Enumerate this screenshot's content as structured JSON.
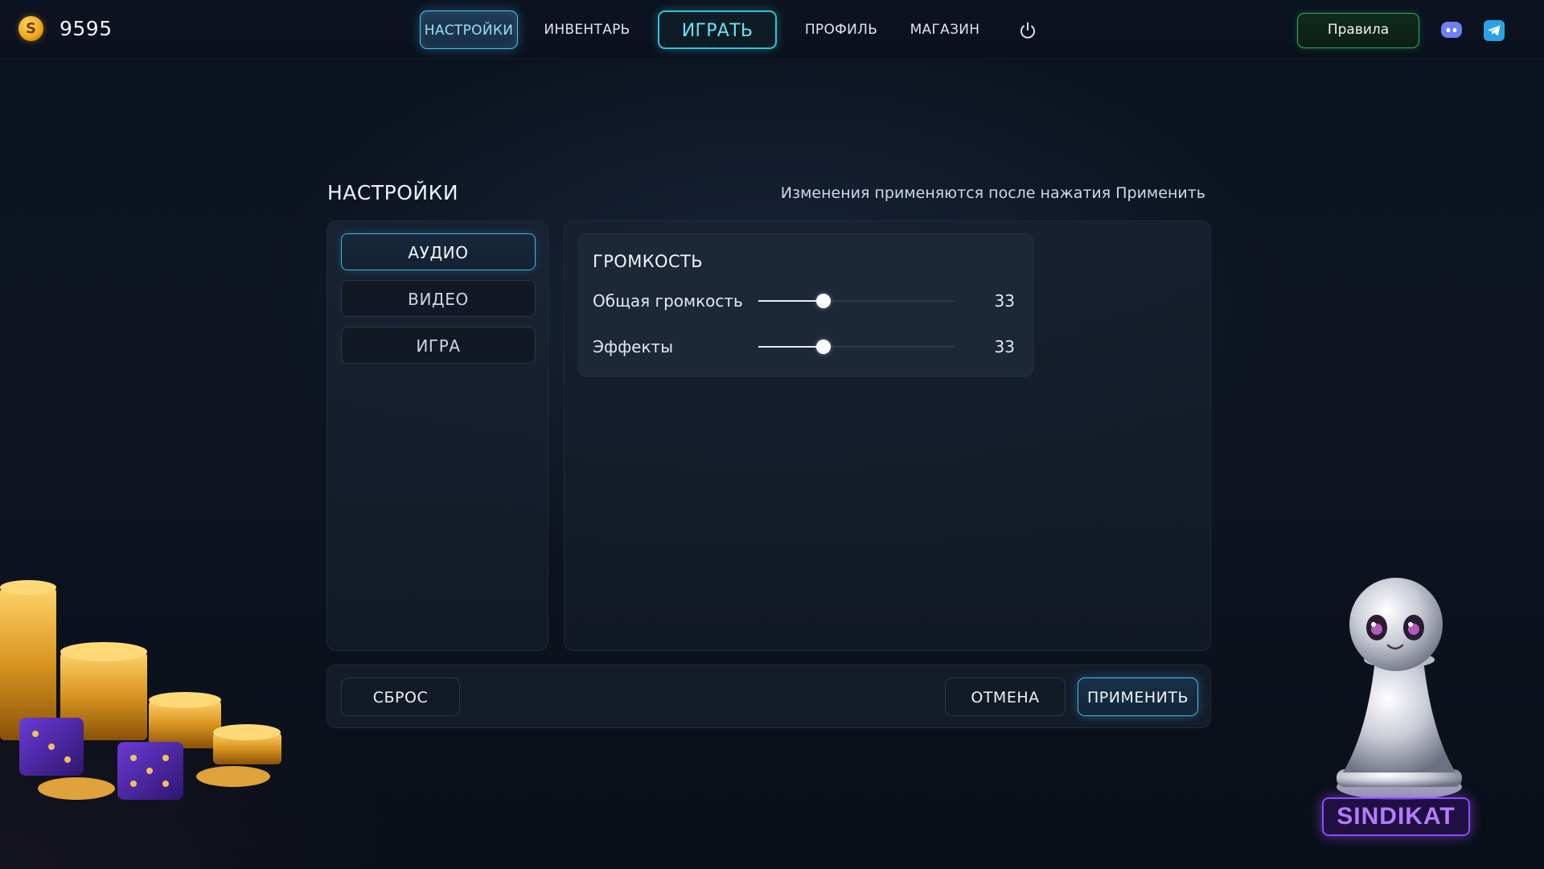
{
  "header": {
    "balance": "9595",
    "coin_symbol": "S",
    "nav": {
      "settings": "НАСТРОЙКИ",
      "inventory": "ИНВЕНТАРЬ",
      "play": "ИГРАТЬ",
      "profile": "ПРОФИЛЬ",
      "shop": "МАГАЗИН"
    },
    "rules_label": "Правила",
    "icons": [
      "coin-icon",
      "power-icon",
      "discord-icon",
      "telegram-icon"
    ]
  },
  "settings": {
    "title": "НАСТРОЙКИ",
    "hint": "Изменения применяются после нажатия Применить",
    "tabs": [
      {
        "label": "АУДИО",
        "active": true
      },
      {
        "label": "ВИДЕО",
        "active": false
      },
      {
        "label": "ИГРА",
        "active": false
      }
    ],
    "volume": {
      "title": "ГРОМКОСТЬ",
      "rows": [
        {
          "label": "Общая громкость",
          "value": "33",
          "level": 0.33
        },
        {
          "label": "Эффекты",
          "value": "33",
          "level": 0.33
        }
      ]
    },
    "footer": {
      "reset": "СБРОС",
      "cancel": "ОТМЕНА",
      "apply": "ПРИМЕНИТЬ"
    }
  },
  "brand": {
    "logo_text": "SINDIKAT"
  },
  "colors": {
    "accent_cyan": "#3fc0e6",
    "rules_green": "#2fb35e",
    "brand_purple": "#8d4bff",
    "coin_gold": "#f0a820"
  }
}
